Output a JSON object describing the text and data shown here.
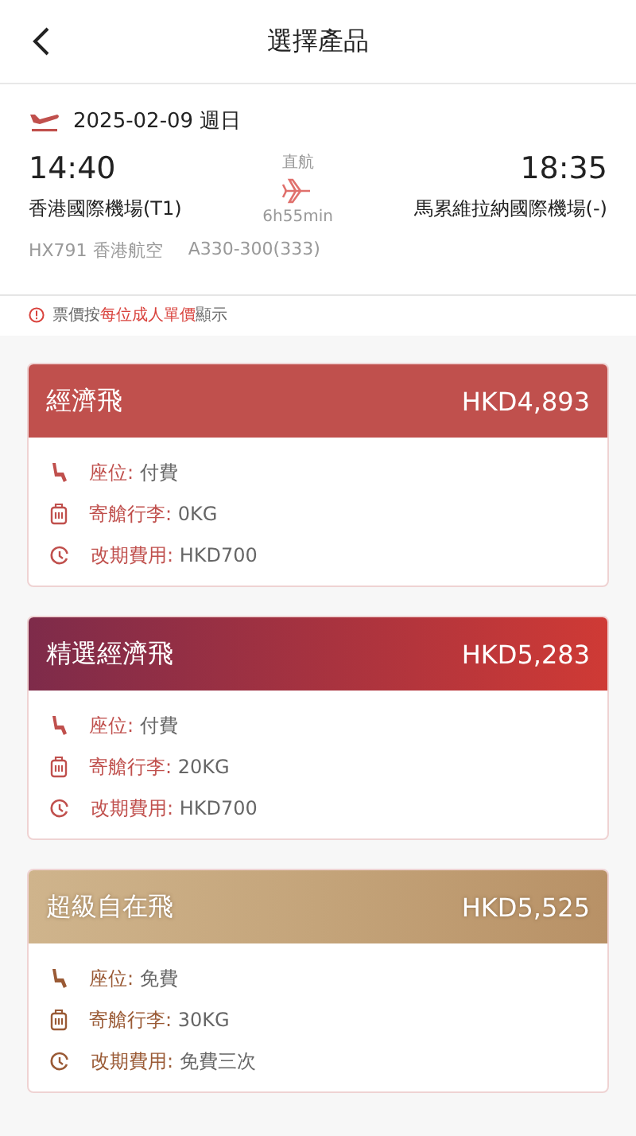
{
  "header": {
    "title": "選擇產品"
  },
  "flight": {
    "date": "2025-02-09 週日",
    "depart_time": "14:40",
    "depart_airport": "香港國際機場(T1)",
    "arrive_time": "18:35",
    "arrive_airport": "馬累維拉納國際機場(-)",
    "stop_type": "直航",
    "duration": "6h55min",
    "flight_no": "HX791 香港航空",
    "aircraft": "A330-300(333)"
  },
  "notice": {
    "before": "票價按",
    "highlight": "每位成人單價",
    "after": "顯示"
  },
  "fares": [
    {
      "kind": "economy",
      "name": "經濟飛",
      "price": "HKD4,893",
      "features": [
        {
          "kind": "seat",
          "label": "座位:",
          "value": "付費"
        },
        {
          "kind": "baggage",
          "label": "寄艙行李:",
          "value": "0KG"
        },
        {
          "kind": "change",
          "label": "改期費用:",
          "value": "HKD700"
        }
      ]
    },
    {
      "kind": "premium",
      "name": "精選經濟飛",
      "price": "HKD5,283",
      "features": [
        {
          "kind": "seat",
          "label": "座位:",
          "value": "付費"
        },
        {
          "kind": "baggage",
          "label": "寄艙行李:",
          "value": "20KG"
        },
        {
          "kind": "change",
          "label": "改期費用:",
          "value": "HKD700"
        }
      ]
    },
    {
      "kind": "super",
      "name": "超級自在飛",
      "price": "HKD5,525",
      "features": [
        {
          "kind": "seat",
          "label": "座位:",
          "value": "免費"
        },
        {
          "kind": "baggage",
          "label": "寄艙行李:",
          "value": "30KG"
        },
        {
          "kind": "change",
          "label": "改期費用:",
          "value": "免費三次"
        }
      ]
    }
  ]
}
